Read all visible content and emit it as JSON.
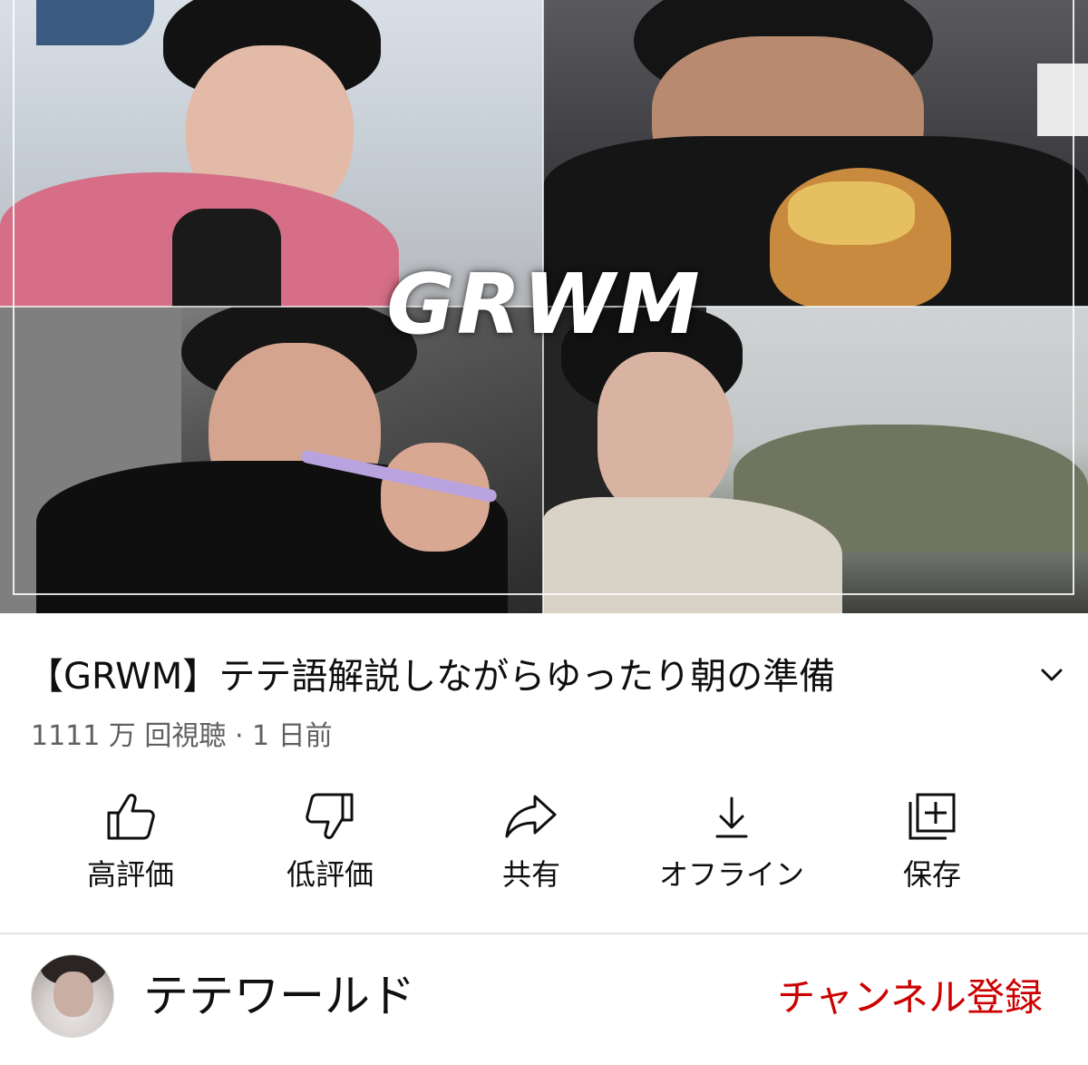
{
  "thumbnail": {
    "overlay_text": "GRWM"
  },
  "video": {
    "title": "【GRWM】テテ語解説しながらゆったり朝の準備",
    "meta": "1111 万 回視聴 · 1 日前"
  },
  "actions": [
    {
      "label": "高評価",
      "icon": "thumbs-up-icon"
    },
    {
      "label": "低評価",
      "icon": "thumbs-down-icon"
    },
    {
      "label": "共有",
      "icon": "share-icon"
    },
    {
      "label": "オフライン",
      "icon": "download-icon"
    },
    {
      "label": "保存",
      "icon": "save-to-playlist-icon"
    }
  ],
  "channel": {
    "name": "テテワールド",
    "subscribe_label": "チャンネル登録"
  },
  "colors": {
    "subscribe": "#cc0000",
    "meta_text": "#606060",
    "separator": "#e5e5e5"
  }
}
